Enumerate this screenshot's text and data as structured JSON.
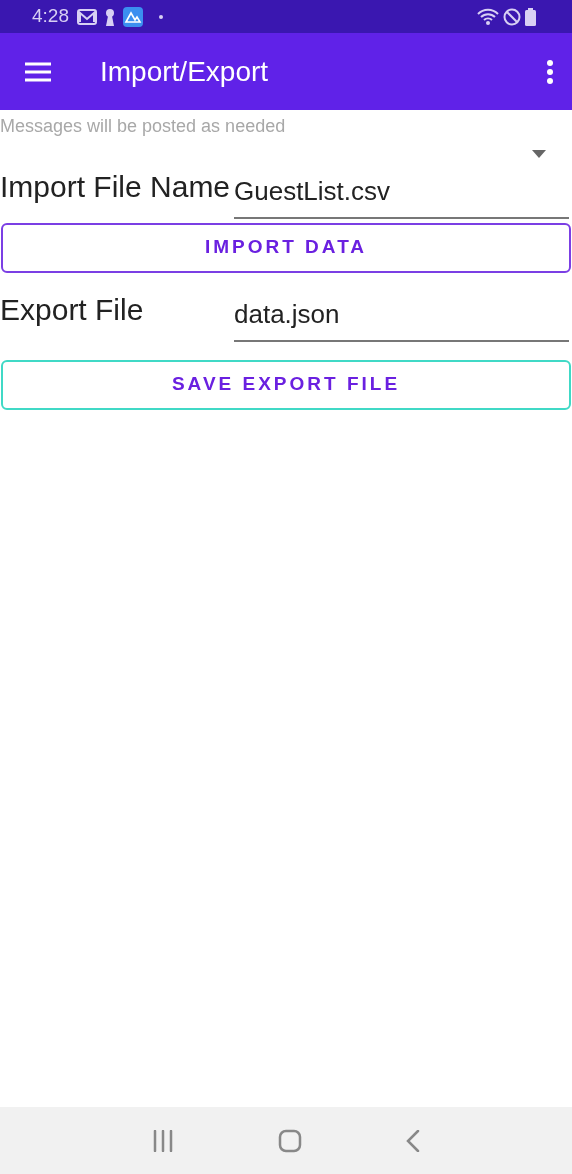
{
  "status_bar": {
    "time": "4:28"
  },
  "app_bar": {
    "title": "Import/Export"
  },
  "message": {
    "text": "Messages will be posted as needed"
  },
  "fields": [
    {
      "label": "Import File Name",
      "value": "GuestList.csv"
    },
    {
      "label": "Export File",
      "value": "data.json"
    }
  ],
  "buttons": [
    {
      "label": "IMPORT DATA",
      "color": "#7b3fe4"
    },
    {
      "label": "SAVE EXPORT FILE",
      "color": "#40d9c6"
    }
  ]
}
